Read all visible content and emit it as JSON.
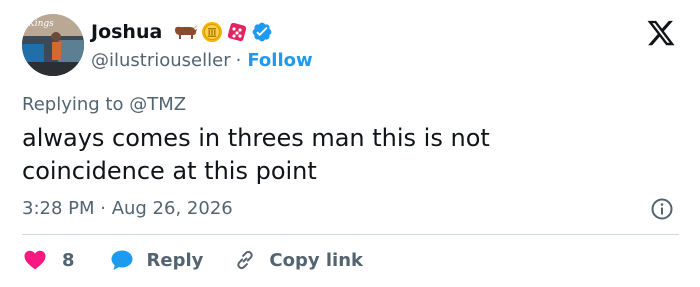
{
  "user": {
    "display_name": "Joshua",
    "handle": "@ilustriouseller",
    "separator": "·",
    "follow_label": "Follow",
    "avatar_text": "Kings",
    "badges": [
      "bull-icon",
      "coin-icon",
      "dice-icon",
      "verified-icon"
    ]
  },
  "reply_context": {
    "prefix": "Replying to",
    "mention": "@TMZ"
  },
  "tweet": {
    "text_line1": "always comes in threes man this is not",
    "text_line2": "coincidence at this point",
    "timestamp": "3:28 PM · Aug 26, 2026"
  },
  "actions": {
    "like_count": "8",
    "reply_label": "Reply",
    "copy_label": "Copy link"
  },
  "colors": {
    "accent": "#1d9bf0",
    "like": "#f91880",
    "muted": "#536471",
    "divider": "#cfd9de",
    "verified": "#1d9bf0"
  }
}
